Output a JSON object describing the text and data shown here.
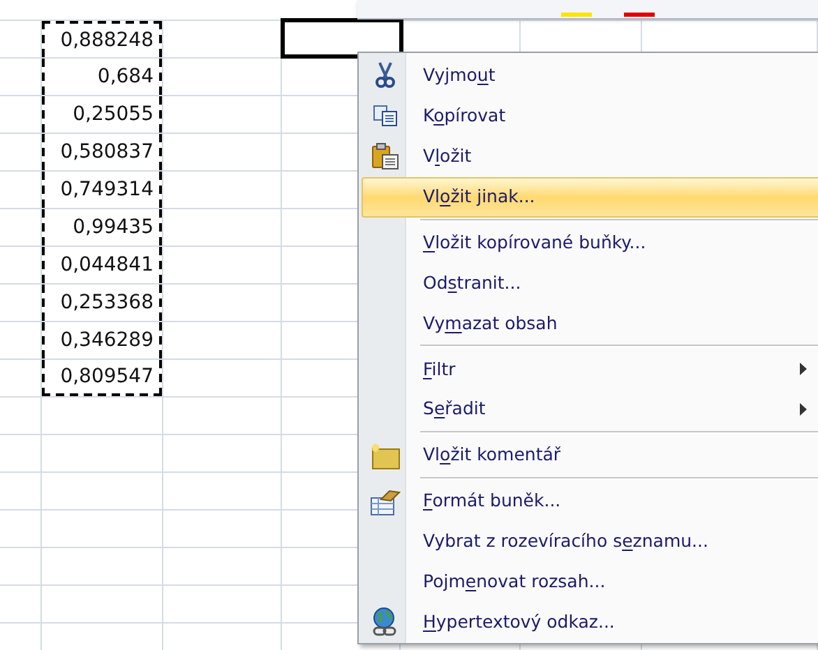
{
  "sheet": {
    "values": [
      "0,888248",
      "0,684",
      "0,25055",
      "0,580837",
      "0,749314",
      "0,99435",
      "0,044841",
      "0,253368",
      "0,346289",
      "0,809547"
    ]
  },
  "menu": {
    "items": [
      {
        "kind": "cut",
        "label": {
          "before": "Vyjmo",
          "key": "u",
          "after": "t"
        },
        "selected": false
      },
      {
        "kind": "copy",
        "label": {
          "before": "K",
          "key": "o",
          "after": "pírovat"
        },
        "selected": false
      },
      {
        "kind": "paste",
        "label": {
          "before": "V",
          "key": "l",
          "after": "ožit"
        },
        "selected": false
      },
      {
        "kind": "plain",
        "label": {
          "before": "Vl",
          "key": "o",
          "after": "žit jinak..."
        },
        "selected": true
      },
      {
        "kind": "separator"
      },
      {
        "kind": "plain",
        "label": {
          "key": "V",
          "after": "ložit kopírované buňky..."
        },
        "selected": false
      },
      {
        "kind": "plain",
        "label": {
          "before": "Od",
          "key": "s",
          "after": "tranit..."
        },
        "selected": false
      },
      {
        "kind": "plain",
        "label": {
          "before": "Vy",
          "key": "m",
          "after": "azat obsah"
        },
        "selected": false
      },
      {
        "kind": "separator"
      },
      {
        "kind": "submenu",
        "label": {
          "key": "F",
          "after": "iltr"
        },
        "selected": false
      },
      {
        "kind": "submenu",
        "label": {
          "before": "S",
          "key": "e",
          "after": "řadit"
        },
        "selected": false
      },
      {
        "kind": "separator"
      },
      {
        "kind": "comment",
        "label": {
          "before": "Vl",
          "key": "o",
          "after": "žit komentář"
        },
        "selected": false
      },
      {
        "kind": "separator"
      },
      {
        "kind": "format",
        "label": {
          "key": "F",
          "after": "ormát buněk..."
        },
        "selected": false
      },
      {
        "kind": "plain",
        "label": {
          "before": "Vybrat z rozevíracího s",
          "key": "e",
          "after": "znamu..."
        },
        "selected": false
      },
      {
        "kind": "plain",
        "label": {
          "before": "Pojm",
          "key": "e",
          "after": "novat rozsah..."
        },
        "selected": false
      },
      {
        "kind": "link",
        "label": {
          "key": "H",
          "after": "ypertextový odkaz..."
        },
        "selected": false
      }
    ]
  }
}
